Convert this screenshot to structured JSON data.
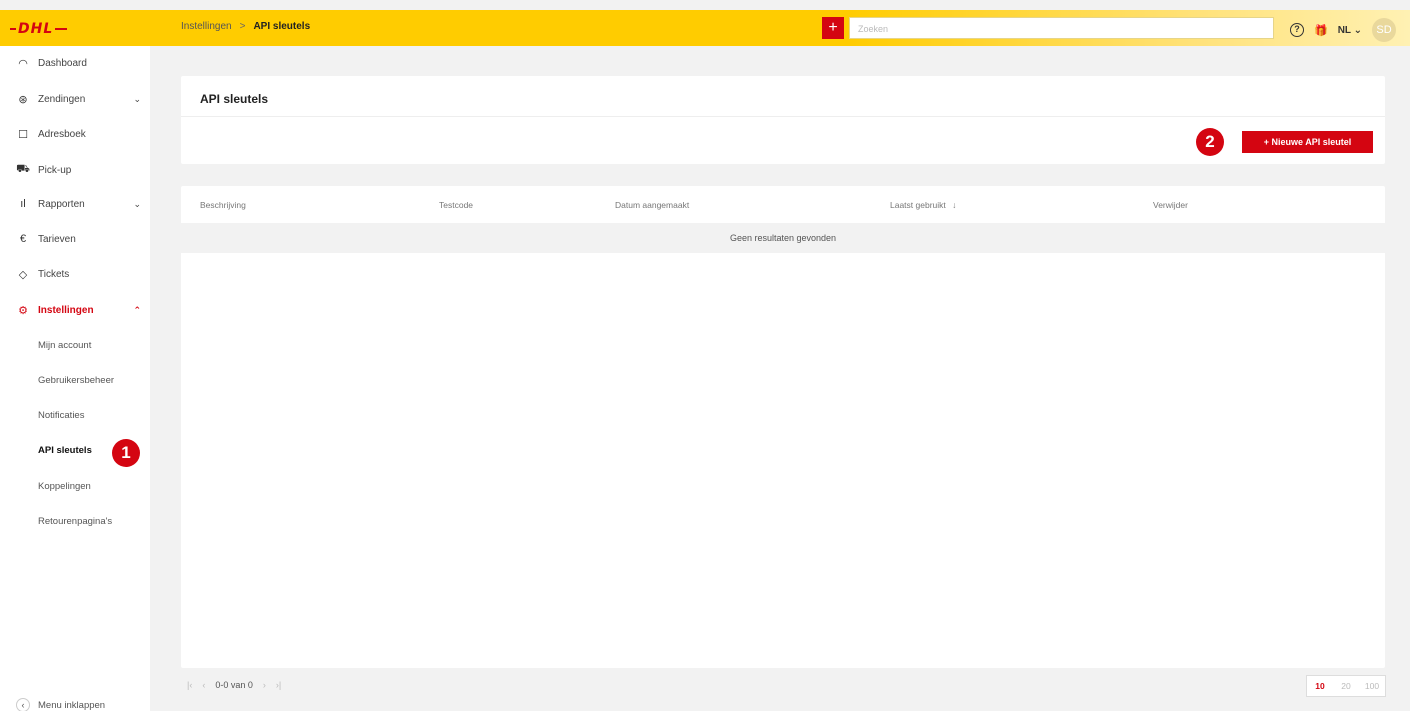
{
  "header": {
    "logo": "DHL",
    "breadcrumb": {
      "parent": "Instellingen",
      "separator": ">",
      "current": "API sleutels"
    },
    "add_label": "+",
    "search_placeholder": "Zoeken",
    "help_icon": "?",
    "gift_icon": "🎁",
    "language": "NL",
    "language_caret": "⌄",
    "avatar": "SD"
  },
  "sidebar": {
    "items": [
      {
        "icon": "gauge-icon",
        "label": "Dashboard"
      },
      {
        "icon": "package-icon",
        "label": "Zendingen",
        "chevron": "⌄"
      },
      {
        "icon": "book-icon",
        "label": "Adresboek"
      },
      {
        "icon": "truck-icon",
        "label": "Pick-up"
      },
      {
        "icon": "bar-chart-icon",
        "label": "Rapporten",
        "chevron": "⌄"
      },
      {
        "icon": "euro-icon",
        "label": "Tarieven"
      },
      {
        "icon": "ticket-icon",
        "label": "Tickets"
      },
      {
        "icon": "gear-icon",
        "label": "Instellingen",
        "chevron": "⌃"
      }
    ],
    "sub_items": [
      "Mijn account",
      "Gebruikersbeheer",
      "Notificaties",
      "API sleutels",
      "Koppelingen",
      "Retourenpagina's"
    ],
    "collapse_label": "Menu inklappen"
  },
  "page": {
    "title": "API sleutels",
    "new_button": "+   Nieuwe API sleutel",
    "badge_1": "1",
    "badge_2": "2"
  },
  "table": {
    "columns": [
      "Beschrijving",
      "Testcode",
      "Datum aangemaakt",
      "Laatst gebruikt",
      "Verwijder"
    ],
    "sort_indicator": "↓",
    "empty_message": "Geen resultaten gevonden"
  },
  "pagination": {
    "first": "|‹",
    "prev": "‹",
    "info": "0-0 van 0",
    "next": "›",
    "last": "›|",
    "sizes": [
      "10",
      "20",
      "100"
    ],
    "selected_size": "10"
  },
  "colors": {
    "brand_yellow": "#ffcc00",
    "brand_red": "#d40511"
  }
}
